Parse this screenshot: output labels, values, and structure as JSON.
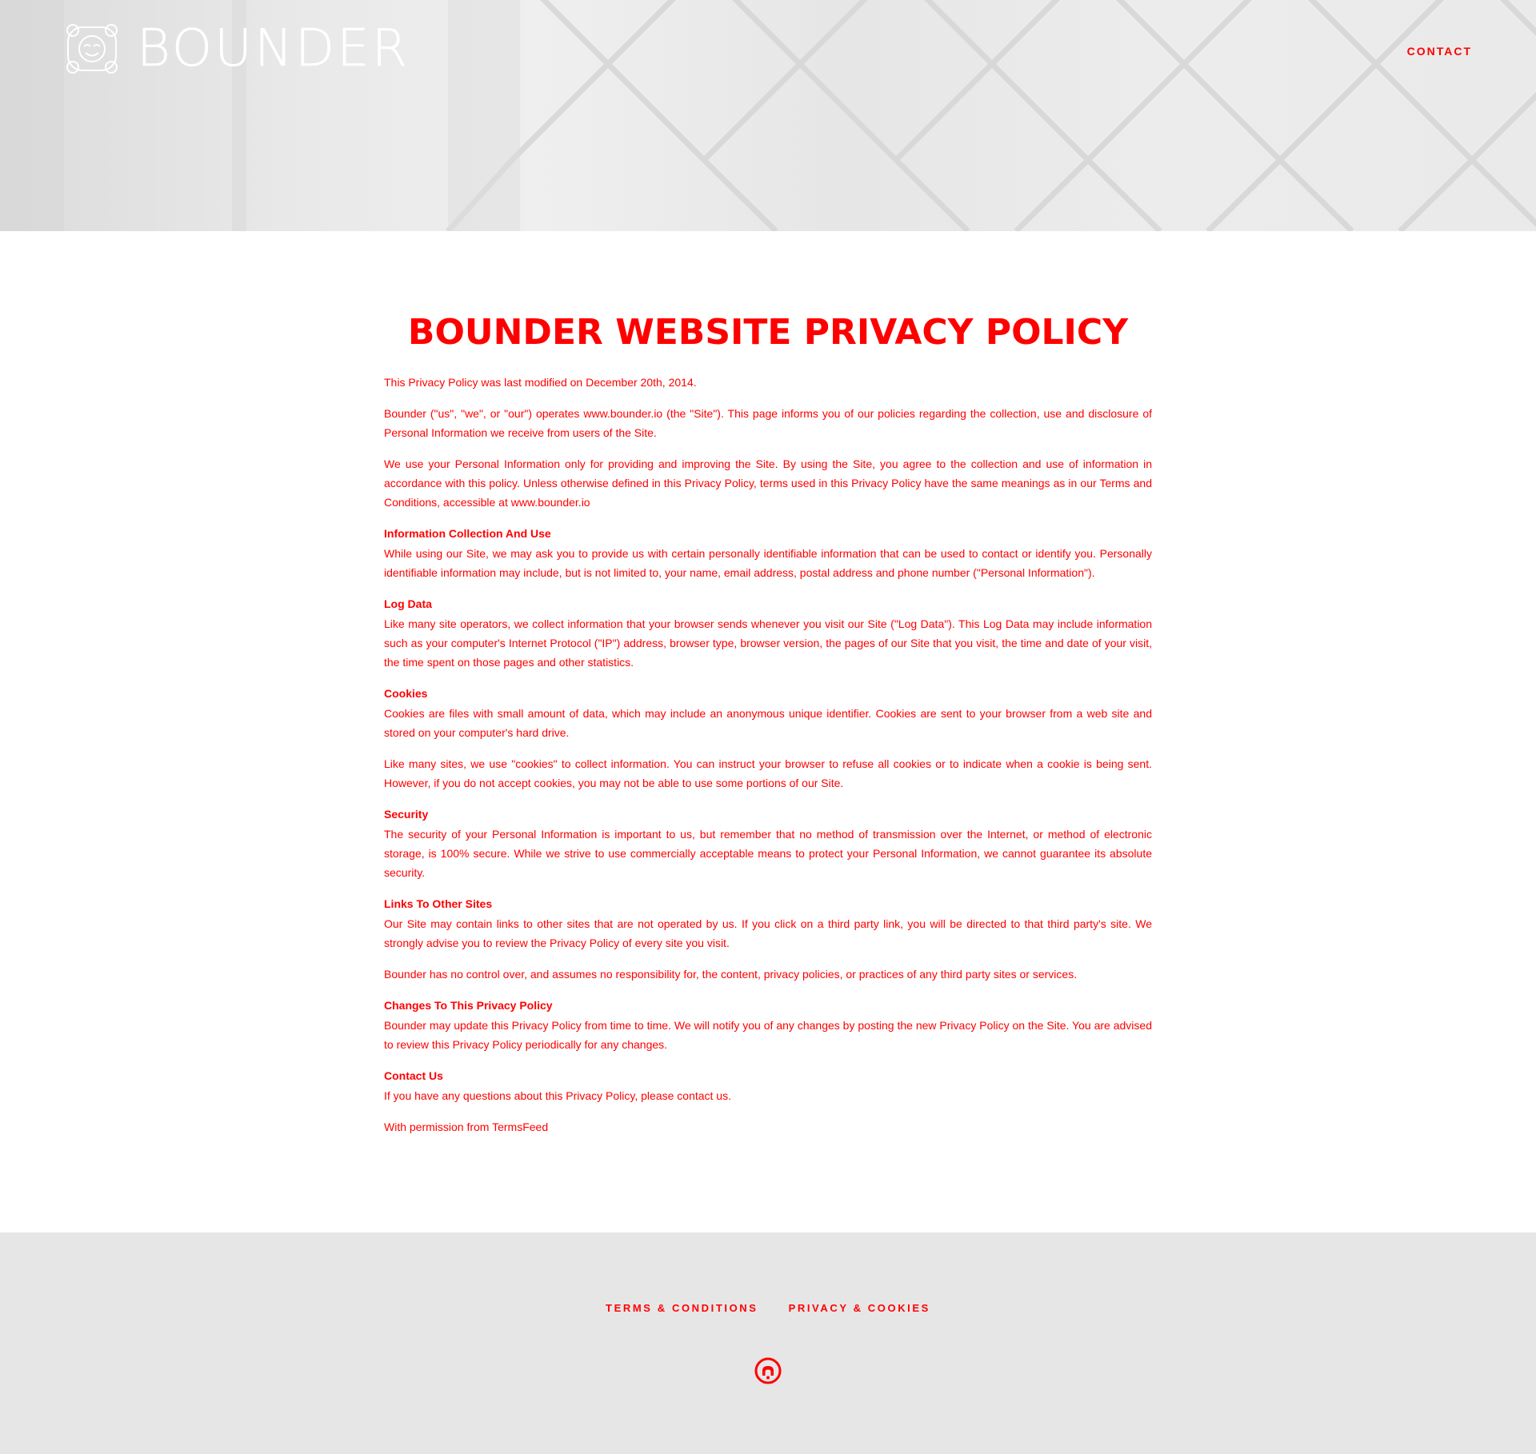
{
  "header": {
    "logo_text": "BOUNDER",
    "nav_contact": "CONTACT"
  },
  "page": {
    "title": "BOUNDER WEBSITE PRIVACY POLICY",
    "intro": [
      "This Privacy Policy was last modified on December 20th, 2014.",
      "Bounder (\"us\", \"we\", or \"our\") operates www.bounder.io (the \"Site\"). This page informs you of our policies regarding the collection, use and disclosure of Personal Information we receive from users of the Site.",
      "We use your Personal Information only for providing and improving the Site. By using the Site, you agree to the collection and use of information in accordance with this policy. Unless otherwise defined in this Privacy Policy, terms used in this Privacy Policy have the same meanings as in our Terms and Conditions, accessible at www.bounder.io"
    ],
    "sections": [
      {
        "heading": "Information Collection And Use",
        "body": "While using our Site, we may ask you to provide us with certain personally identifiable information that can be used to contact or identify you. Personally identifiable information may include, but is not limited to, your name, email address, postal address and phone number (\"Personal Information\")."
      },
      {
        "heading": "Log Data",
        "body": "Like many site operators, we collect information that your browser sends whenever you visit our Site (\"Log Data\"). This Log Data may include information such as your computer's Internet Protocol (\"IP\") address, browser type, browser version, the pages of our Site that you visit, the time and date of your visit, the time spent on those pages and other statistics."
      },
      {
        "heading": "Cookies",
        "body": "Cookies are files with small amount of data, which may include an anonymous unique identifier. Cookies are sent to your browser from a web site and stored on your computer's hard drive.",
        "extra": "Like many sites, we use \"cookies\" to collect information. You can instruct your browser to refuse all cookies or to indicate when a cookie is being sent. However, if you do not accept cookies, you may not be able to use some portions of our Site."
      },
      {
        "heading": "Security",
        "body": "The security of your Personal Information is important to us, but remember that no method of transmission over the Internet, or method of electronic storage, is 100% secure. While we strive to use commercially acceptable means to protect your Personal Information, we cannot guarantee its absolute security."
      },
      {
        "heading": "Links To Other Sites",
        "body": "Our Site may contain links to other sites that are not operated by us. If you click on a third party link, you will be directed to that third party's site. We strongly advise you to review the Privacy Policy of every site you visit.",
        "extra": "Bounder has no control over, and assumes no responsibility for, the content, privacy policies, or practices of any third party sites or services."
      },
      {
        "heading": "Changes To This Privacy Policy",
        "body": "Bounder may update this Privacy Policy from time to time. We will notify you of any changes by posting the new Privacy Policy on the Site. You are advised to review this Privacy Policy periodically for any changes."
      },
      {
        "heading": "Contact Us",
        "body": "If you have any questions about this Privacy Policy, please contact us."
      }
    ],
    "footer_note": "With permission from TermsFeed"
  },
  "footer": {
    "links": [
      "TERMS & CONDITIONS",
      "PRIVACY & COOKIES"
    ],
    "icon": "github-icon"
  },
  "colors": {
    "accent": "#ff0000",
    "footer_bg": "#e6e6e6",
    "hero_bg": "#e9e9e9"
  }
}
